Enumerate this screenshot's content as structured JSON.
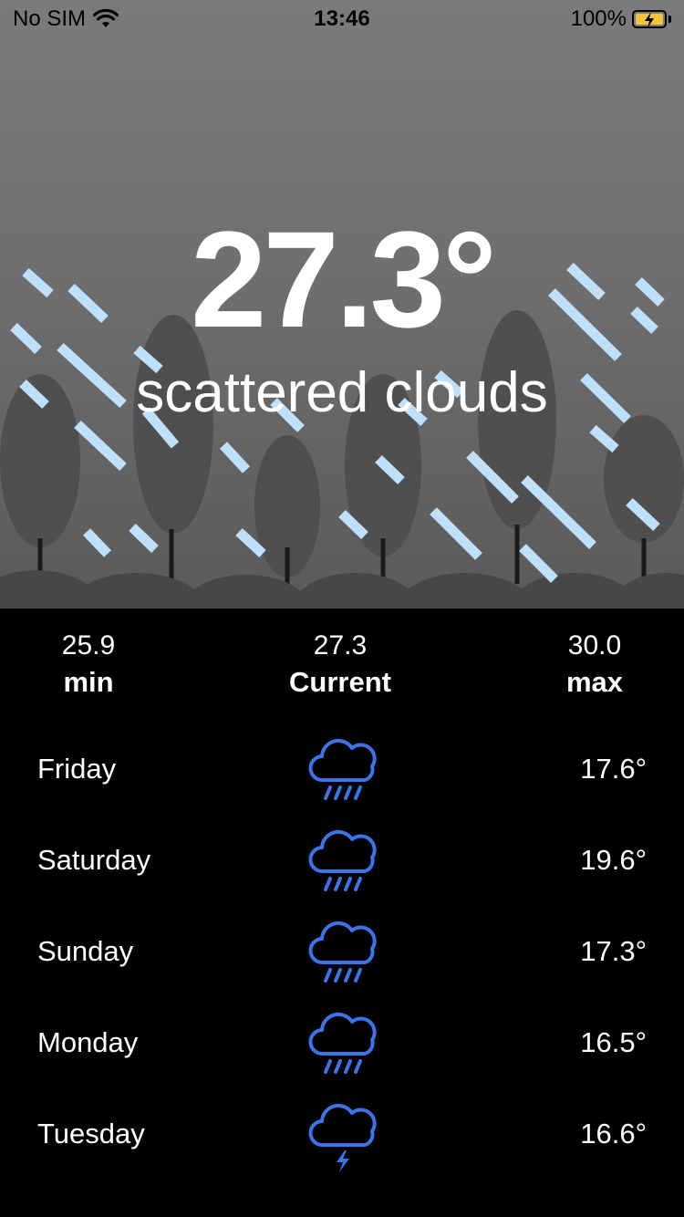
{
  "status_bar": {
    "carrier": "No SIM",
    "time": "13:46",
    "battery": "100%"
  },
  "current": {
    "temperature": "27.3°",
    "description": "scattered clouds"
  },
  "summary": {
    "min": {
      "value": "25.9",
      "label": "min"
    },
    "current": {
      "value": "27.3",
      "label": "Current"
    },
    "max": {
      "value": "30.0",
      "label": "max"
    }
  },
  "forecast": [
    {
      "day": "Friday",
      "icon": "cloud-rain-icon",
      "temp": "17.6°"
    },
    {
      "day": "Saturday",
      "icon": "cloud-rain-icon",
      "temp": "19.6°"
    },
    {
      "day": "Sunday",
      "icon": "cloud-rain-icon",
      "temp": "17.3°"
    },
    {
      "day": "Monday",
      "icon": "cloud-rain-icon",
      "temp": "16.5°"
    },
    {
      "day": "Tuesday",
      "icon": "cloud-lightning-icon",
      "temp": "16.6°"
    }
  ],
  "colors": {
    "icon_blue": "#3a74e8",
    "rain": "#bfe0fb",
    "tree": "#4d4d4d"
  }
}
